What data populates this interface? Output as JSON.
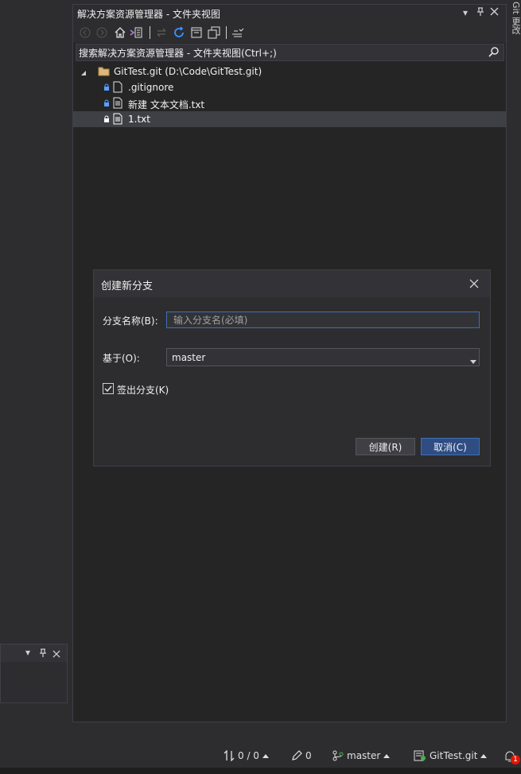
{
  "panel": {
    "title": "解决方案资源管理器 - 文件夹视图",
    "search_placeholder": "搜索解决方案资源管理器 - 文件夹视图(Ctrl+;)"
  },
  "tree": {
    "root": "GitTest.git (D:\\Code\\GitTest.git)",
    "items": [
      ".gitignore",
      "新建 文本文档.txt",
      "1.txt"
    ]
  },
  "dialog": {
    "title": "创建新分支",
    "branch_name_label": "分支名称(B):",
    "branch_name_placeholder": "输入分支名(必填)",
    "base_label": "基于(O):",
    "base_value": "master",
    "checkout_label": "签出分支(K)",
    "create_button": "创建(R)",
    "cancel_button": "取消(C)"
  },
  "side_tab": "Git 更改",
  "statusbar": {
    "sync": "0 / 0",
    "changes": "0",
    "branch": "master",
    "repo": "GitTest.git",
    "notification_count": "1"
  },
  "colors": {
    "accent": "#3f6fb4",
    "primary_button": "#2f4d83",
    "selection": "#3f46",
    "notification": "#e51400"
  }
}
